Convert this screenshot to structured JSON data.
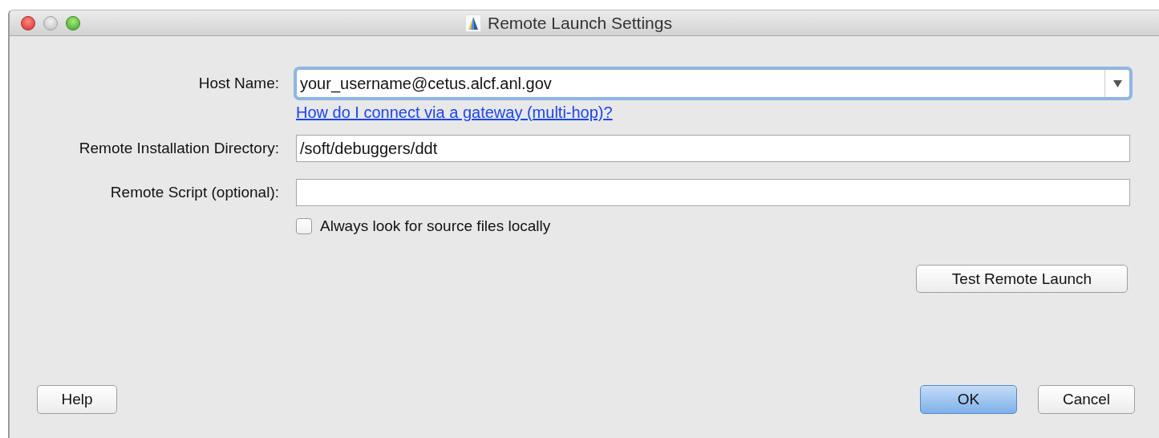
{
  "window": {
    "title": "Remote Launch Settings"
  },
  "fields": [
    {
      "kind": "combo",
      "label": "Host Name:",
      "value": "your_username@cetus.alcf.anl.gov",
      "focused": true,
      "link": "How do I connect via a gateway (multi-hop)?"
    },
    {
      "kind": "text",
      "label": "Remote Installation Directory:",
      "value": "/soft/debuggers/ddt",
      "focused": false
    },
    {
      "kind": "text",
      "label": "Remote Script (optional):",
      "focused": false
    }
  ],
  "checkbox": {
    "label": "Always look for source files locally",
    "checked": false
  },
  "test_button": "Test Remote Launch",
  "buttons": [
    {
      "label": "Help",
      "default": false
    },
    {
      "label": "OK",
      "default": true
    },
    {
      "label": "Cancel",
      "default": false
    }
  ]
}
